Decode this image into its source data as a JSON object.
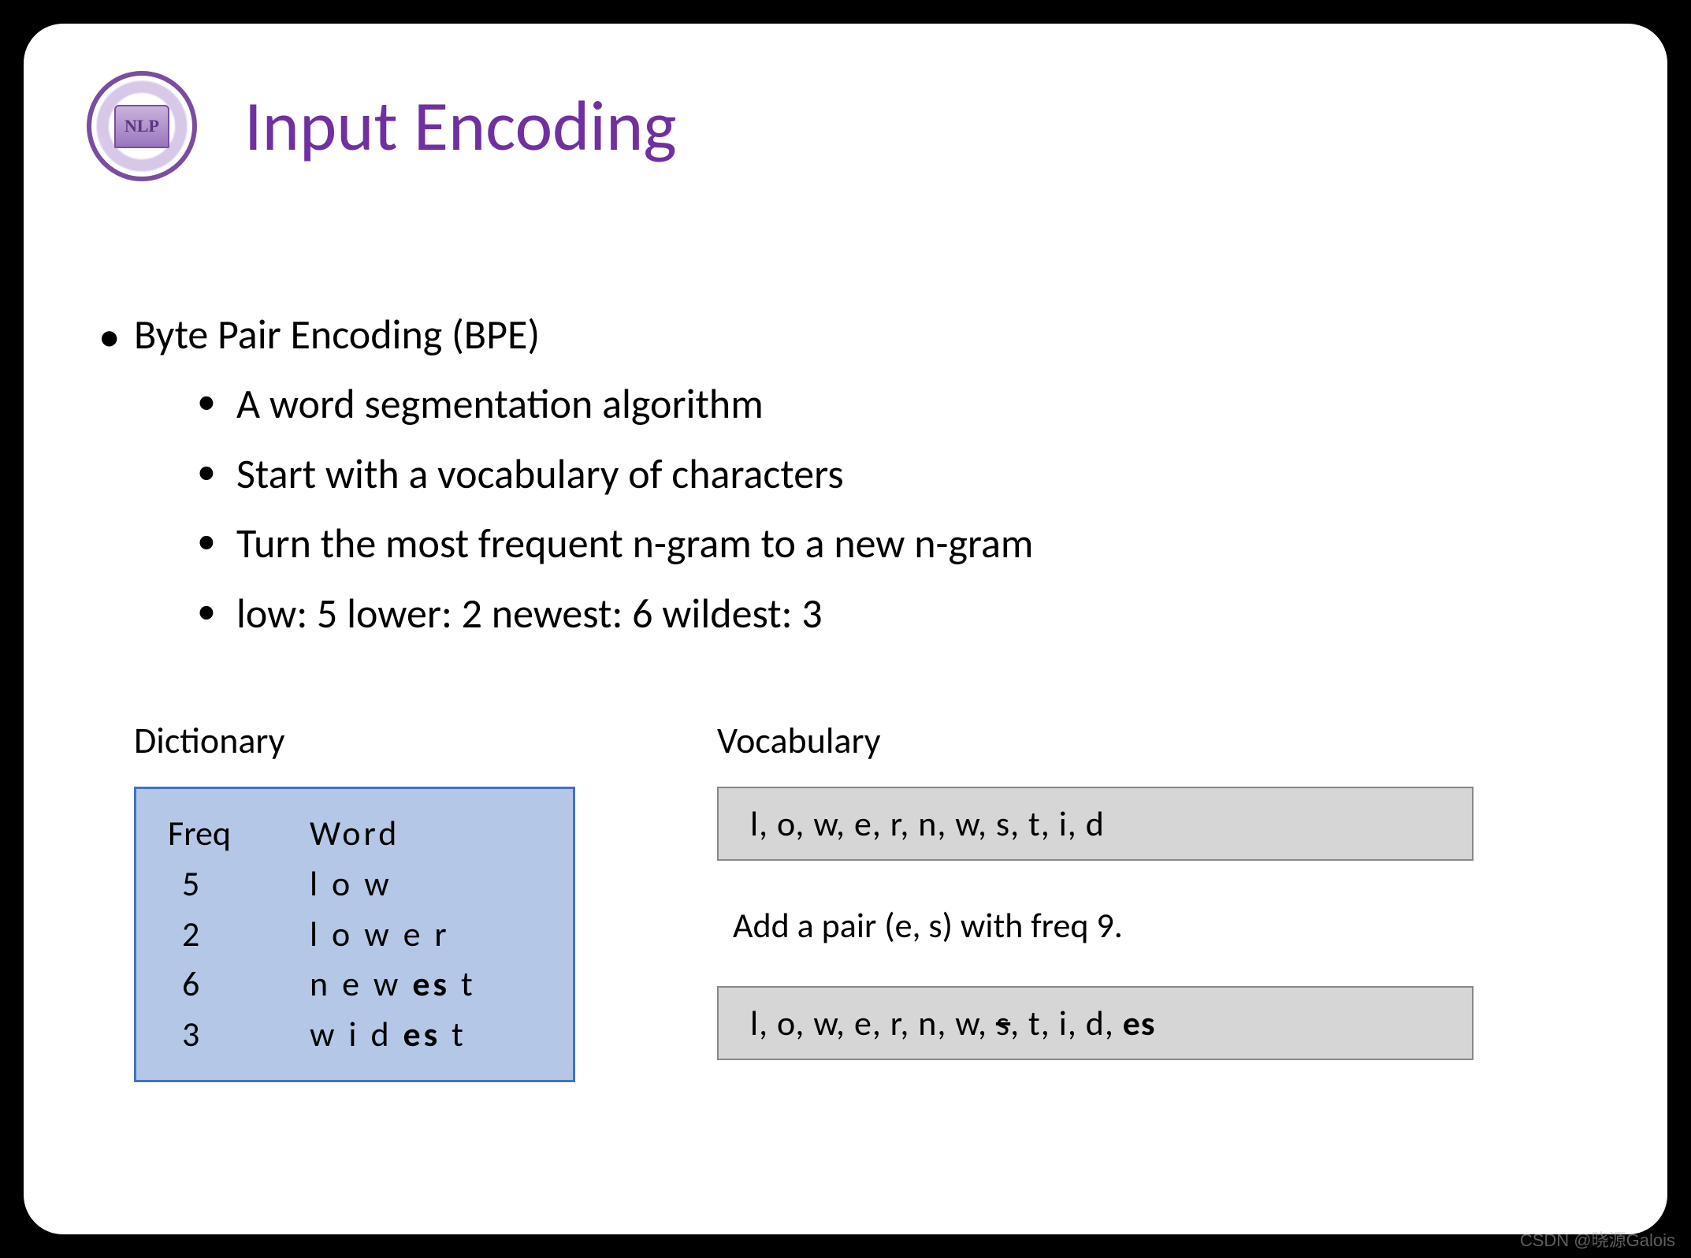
{
  "logo_text": "NLP",
  "title": "Input Encoding",
  "bullets": {
    "main": "Byte Pair Encoding (BPE)",
    "sub1": "A word segmentation algorithm",
    "sub2": "Start with a vocabulary of characters",
    "sub3": "Turn the most frequent n-gram to a new n-gram",
    "sub4": "low: 5 lower: 2 newest: 6 wildest: 3"
  },
  "dictionary": {
    "title": "Dictionary",
    "header_freq": "Freq",
    "header_word": "Word",
    "rows": [
      {
        "freq": "5",
        "word_pre": "l o w",
        "word_bold": "",
        "word_post": ""
      },
      {
        "freq": "2",
        "word_pre": "l o w e r",
        "word_bold": "",
        "word_post": ""
      },
      {
        "freq": "6",
        "word_pre": "n e w ",
        "word_bold": "es",
        "word_post": " t"
      },
      {
        "freq": "3",
        "word_pre": "w i d ",
        "word_bold": "es",
        "word_post": " t"
      }
    ]
  },
  "vocabulary": {
    "title": "Vocabulary",
    "box1": "l, o, w, e, r, n, w, s, t, i, d",
    "note": "Add a pair (e, s) with freq 9.",
    "box2_pre": "l, o, w, e, r, n, w, ",
    "box2_strike": "s",
    "box2_mid": ", t, i, d, ",
    "box2_bold": "es"
  },
  "watermark": "CSDN @晓源Galois"
}
